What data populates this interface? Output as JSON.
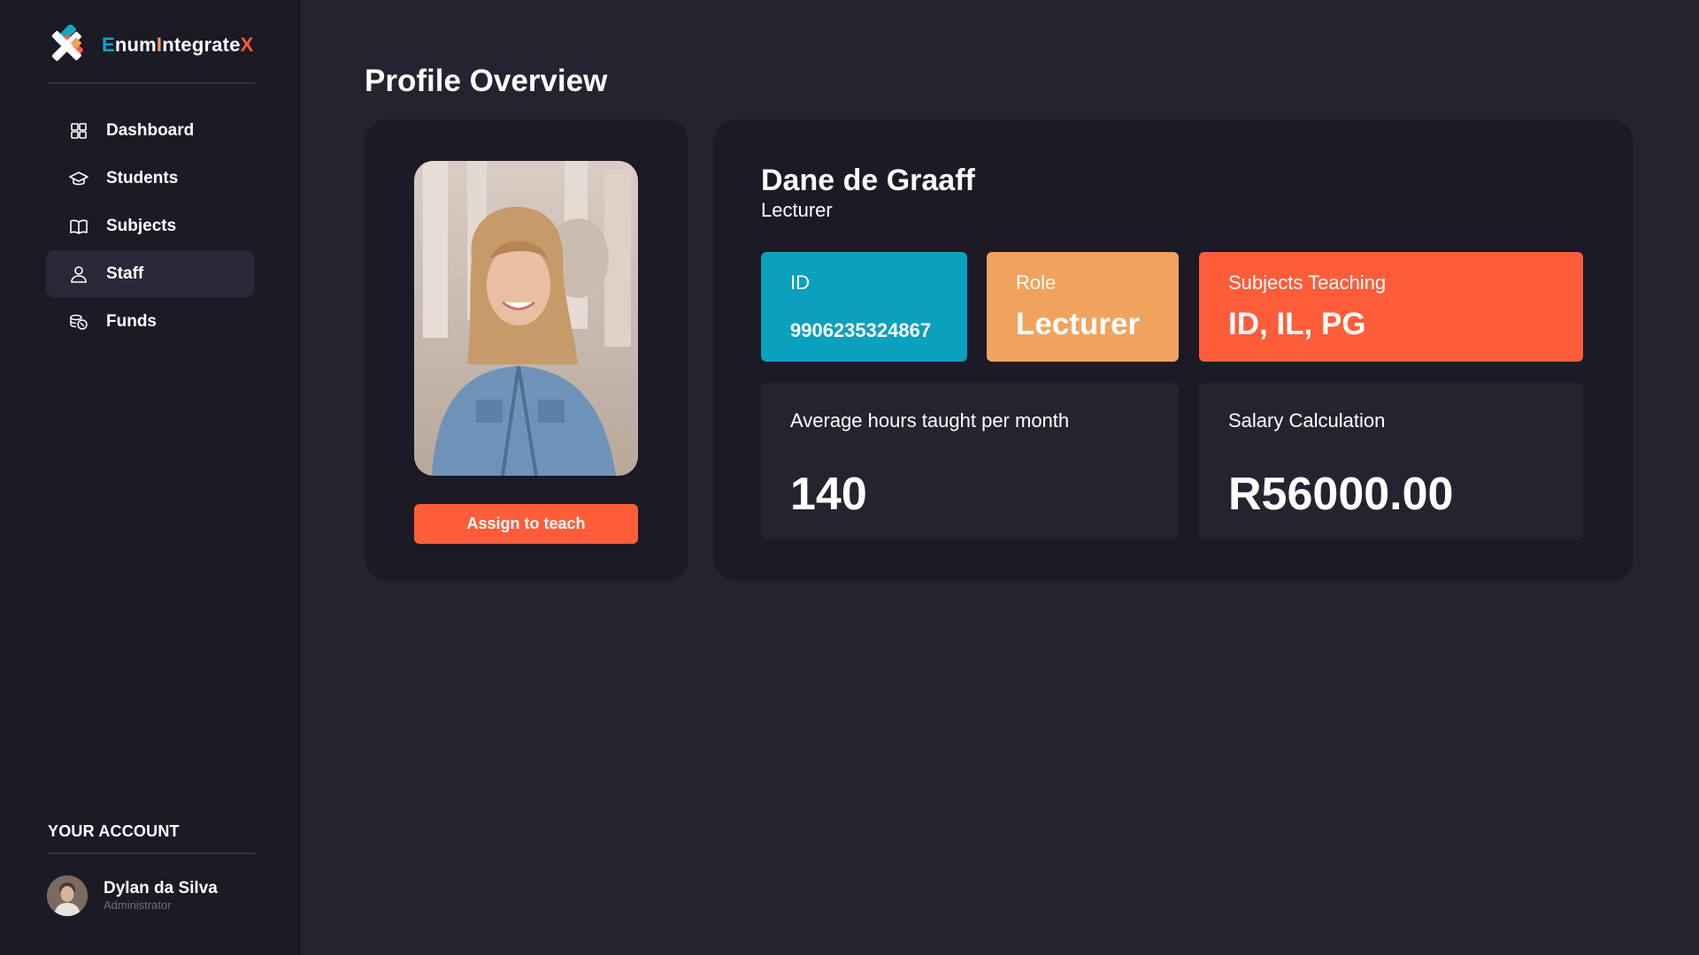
{
  "brand": {
    "part1": "E",
    "part2": "num",
    "part3": "I",
    "part4": "ntegrate",
    "part5": "X"
  },
  "sidebar": {
    "items": [
      {
        "label": "Dashboard",
        "icon": "dashboard-grid-icon"
      },
      {
        "label": "Students",
        "icon": "graduation-cap-icon"
      },
      {
        "label": "Subjects",
        "icon": "book-icon"
      },
      {
        "label": "Staff",
        "icon": "user-icon",
        "active": true
      },
      {
        "label": "Funds",
        "icon": "coins-icon"
      }
    ]
  },
  "account": {
    "section_title": "YOUR ACCOUNT",
    "name": "Dylan da Silva",
    "role": "Administrator"
  },
  "main": {
    "title": "Profile Overview",
    "assign_button": "Assign to teach",
    "person": {
      "name": "Dane de Graaff",
      "role": "Lecturer"
    },
    "tiles": {
      "id": {
        "label": "ID",
        "value": "9906235324867"
      },
      "role": {
        "label": "Role",
        "value": "Lecturer"
      },
      "subjects": {
        "label": "Subjects Teaching",
        "value": "ID, IL, PG"
      },
      "hours": {
        "label": "Average hours taught per month",
        "value": "140"
      },
      "salary": {
        "label": "Salary Calculation",
        "value": "R56000.00"
      }
    }
  },
  "colors": {
    "accent_orange_red": "#ff5c39",
    "accent_orange": "#f0a35e",
    "accent_teal": "#0ba0bd",
    "sidebar_bg": "#1b1a25",
    "page_bg": "#25232f"
  }
}
